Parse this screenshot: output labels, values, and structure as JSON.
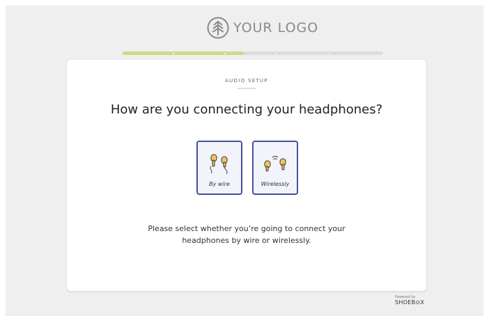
{
  "logo": {
    "text": "YOUR LOGO",
    "icon": "tree-icon"
  },
  "progress": {
    "completed_fraction": 0.465,
    "steps": 5
  },
  "card": {
    "eyebrow": "AUDIO SETUP",
    "question": "How are you connecting your headphones?",
    "options": [
      {
        "label": "By wire",
        "icon": "wired-earbuds-icon"
      },
      {
        "label": "Wirelessly",
        "icon": "wireless-earbuds-icon"
      }
    ],
    "description": "Please select whether you’re going to connect your headphones by wire or wirelessly."
  },
  "footer": {
    "powered_by": "Powered by",
    "brand": "SHOEB⊙X"
  },
  "colors": {
    "accent": "#43509a",
    "progress_fill": "#c7dc87",
    "earbud": "#f2c660"
  }
}
